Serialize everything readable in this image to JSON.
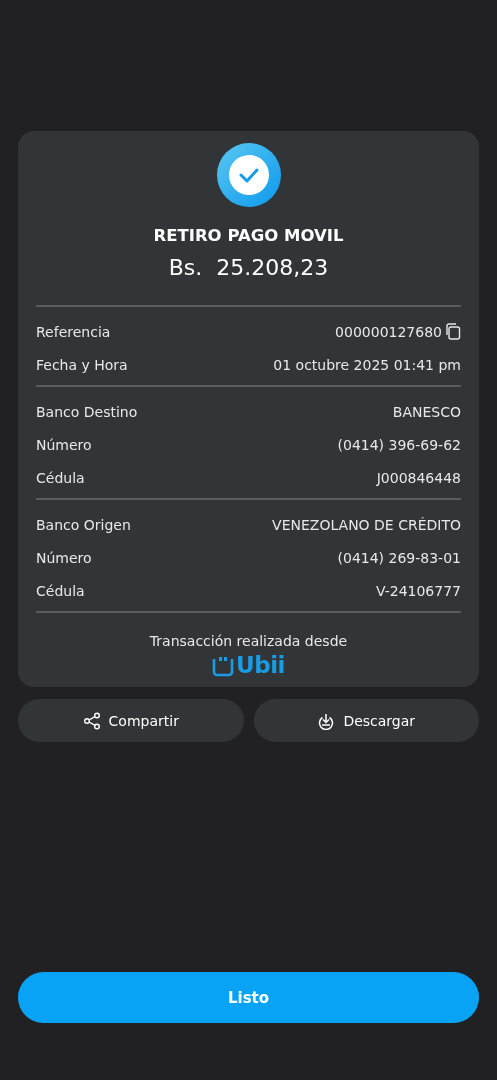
{
  "receipt": {
    "title": "RETIRO PAGO MOVIL",
    "amount": "Bs.  25.208,23",
    "sections": [
      {
        "rows": [
          {
            "label": "Referencia",
            "value": "000000127680",
            "copy": true
          },
          {
            "label": "Fecha y Hora",
            "value": "01 octubre 2025 01:41 pm",
            "copy": false
          }
        ]
      },
      {
        "rows": [
          {
            "label": "Banco Destino",
            "value": "BANESCO",
            "copy": false
          },
          {
            "label": "Número",
            "value": "(0414) 396-69-62",
            "copy": false
          },
          {
            "label": "Cédula",
            "value": "J000846448",
            "copy": false
          }
        ]
      },
      {
        "rows": [
          {
            "label": "Banco Origen",
            "value": "VENEZOLANO DE CRÉDITO",
            "copy": false
          },
          {
            "label": "Número",
            "value": "(0414) 269-83-01",
            "copy": false
          },
          {
            "label": "Cédula",
            "value": "V-24106777",
            "copy": false
          }
        ]
      }
    ],
    "footer": "Transacción realizada desde",
    "brand": "Ubii"
  },
  "actions": [
    {
      "kind": "share",
      "label": "Compartir"
    },
    {
      "kind": "download",
      "label": "Descargar"
    }
  ],
  "done_button": "Listo"
}
